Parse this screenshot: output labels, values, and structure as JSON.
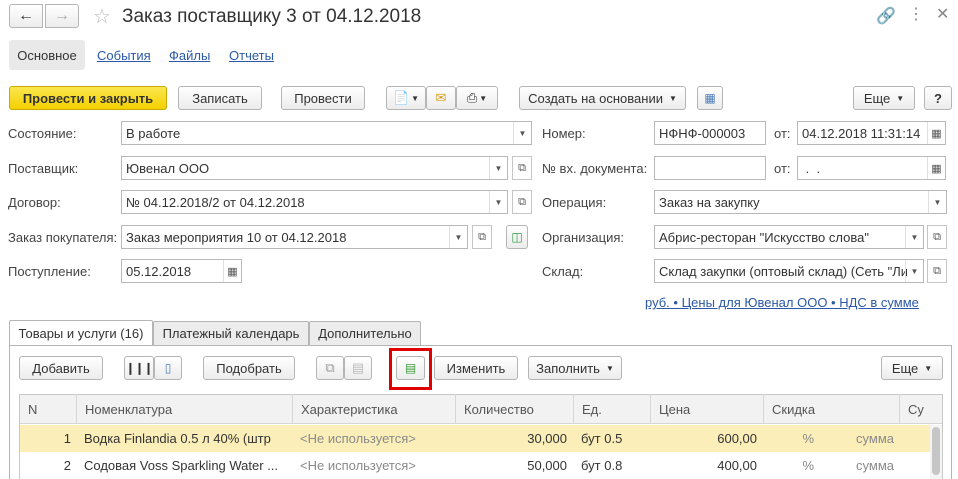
{
  "window": {
    "title": "Заказ поставщику 3 от 04.12.2018"
  },
  "nav_tabs": [
    "Основное",
    "События",
    "Файлы",
    "Отчеты"
  ],
  "toolbar": {
    "post_close": "Провести и закрыть",
    "write": "Записать",
    "post": "Провести",
    "create_based": "Создать на основании",
    "more": "Еще",
    "help": "?"
  },
  "form": {
    "status_label": "Состояние:",
    "status_value": "В работе",
    "supplier_label": "Поставщик:",
    "supplier_value": "Ювенал ООО",
    "contract_label": "Договор:",
    "contract_value": "№ 04.12.2018/2 от 04.12.2018",
    "customer_order_label": "Заказ покупателя:",
    "customer_order_value": "Заказ мероприятия 10 от 04.12.2018",
    "receipt_label": "Поступление:",
    "receipt_value": "05.12.2018",
    "number_label": "Номер:",
    "number_value": "НФНФ-000003",
    "from_label": "от:",
    "date_value": "04.12.2018 11:31:14",
    "incoming_doc_label": "№ вх. документа:",
    "incoming_doc_value": "",
    "incoming_from_label": "от:",
    "incoming_date_value": " .  .",
    "operation_label": "Операция:",
    "operation_value": "Заказ на закупку",
    "org_label": "Организация:",
    "org_value": "Абрис-ресторан \"Искусство слова\"",
    "warehouse_label": "Склад:",
    "warehouse_value": "Склад закупки (оптовый склад) (Сеть \"Ли",
    "price_link": "руб. • Цены для Ювенал ООО • НДС в сумме"
  },
  "doc_tabs": [
    "Товары и услуги (16)",
    "Платежный календарь",
    "Дополнительно"
  ],
  "table_toolbar": {
    "add": "Добавить",
    "pick": "Подобрать",
    "change": "Изменить",
    "fill": "Заполнить",
    "more": "Еще"
  },
  "table": {
    "headers": [
      "N",
      "Номенклатура",
      "Характеристика",
      "Количество",
      "Ед.",
      "Цена",
      "Скидка",
      "Су"
    ],
    "rows": [
      {
        "n": "1",
        "name": "Водка Finlandia 0.5 л 40% (штр",
        "char": "<Не используется>",
        "qty": "30,000",
        "unit": "бут 0.5",
        "price": "600,00",
        "discount": "%",
        "sum": "сумма"
      },
      {
        "n": "2",
        "name": "Содовая Voss Sparkling Water ...",
        "char": "<Не используется>",
        "qty": "50,000",
        "unit": "бут 0.8",
        "price": "400,00",
        "discount": "%",
        "sum": "сумма"
      }
    ]
  }
}
